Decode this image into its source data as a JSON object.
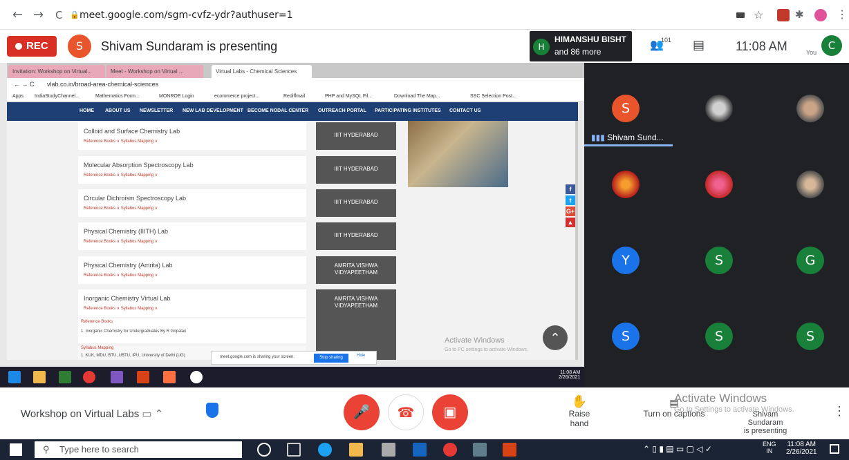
{
  "browser": {
    "url": "meet.google.com/sgm-cvfz-ydr?authuser=1",
    "back_icon": "←",
    "forward_icon": "→",
    "reload_icon": "C"
  },
  "meet_top": {
    "rec_label": "REC",
    "presenter_initial": "S",
    "presenting_text": "Shivam Sundaram is presenting",
    "pinned_initial": "H",
    "pinned_name": "HIMANSHU BISHT",
    "pinned_more": "and 86 more",
    "people_count": "101",
    "time": "11:08 AM",
    "you_label": "You",
    "user_initial": "C"
  },
  "shared_screen": {
    "tabs": [
      "Invitation: Workshop on Virtual...",
      "Meet - Workshop on Virtual ...",
      "Virtual Labs - Chemical Sciences"
    ],
    "address": "vlab.co.in/broad-area-chemical-sciences",
    "bookmarks": [
      "Apps",
      "IndiaStudyChannel...",
      "Mathematics Form...",
      "MONROE Login",
      "ecommerce project...",
      "Rediffmail",
      "PHP and MySQL Fil...",
      "Download The Map...",
      "SSC Selection Post..."
    ],
    "nav": [
      "HOME",
      "ABOUT US",
      "NEWSLETTER",
      "NEW LAB DEVELOPMENT",
      "BECOME NODAL CENTER",
      "OUTREACH PORTAL",
      "PARTICIPATING INSTITUTES",
      "CONTACT US"
    ],
    "labs": [
      {
        "name": "Colloid and Surface Chemistry Lab",
        "links": "Reference Books ∨   Syllabus Mapping ∨",
        "inst": "IIIT HYDERABAD"
      },
      {
        "name": "Molecular Absorption Spectroscopy Lab",
        "links": "Reference Books ∨   Syllabus Mapping ∨",
        "inst": "IIIT HYDERABAD"
      },
      {
        "name": "Circular Dichroism Spectroscopy Lab",
        "links": "Reference Books ∨   Syllabus Mapping ∨",
        "inst": "IIIT HYDERABAD"
      },
      {
        "name": "Physical Chemistry (IIITH) Lab",
        "links": "Reference Books ∨   Syllabus Mapping ∨",
        "inst": "IIIT HYDERABAD"
      },
      {
        "name": "Physical Chemistry (Amrita) Lab",
        "links": "Reference Books ∨   Syllabus Mapping ∨",
        "inst": "AMRITA VISHWA VIDYAPEETHAM"
      },
      {
        "name": "Inorganic Chemistry Virtual Lab",
        "links": "Reference Books ∧   Syllabus Mapping ∧",
        "inst": "AMRITA VISHWA VIDYAPEETHAM"
      }
    ],
    "ref_heading": "Reference Books",
    "ref_item": "1. Inorganic Chemistry for Undergraduates By R Gopalan",
    "syl_heading": "Syllabus Mapping",
    "syl_item": "1. KUK, MDU, BTU, UBTU, IPU, University of Delhi (UG)",
    "share_msg": "meet.google.com is sharing your screen.",
    "stop_label": "Stop sharing",
    "hide_label": "Hide",
    "activate_title": "Activate Windows",
    "activate_sub": "Go to PC settings to activate Windows.",
    "inner_time": "11:08 AM",
    "inner_date": "2/26/2021",
    "social": [
      "f",
      "t",
      "G+",
      "▲"
    ]
  },
  "participants": {
    "speaker_name": "Shivam Sund...",
    "tiles": [
      {
        "initial": "S",
        "color": "#e8542c"
      },
      {
        "initial": "Y",
        "color": "#1a73e8"
      },
      {
        "initial": "S",
        "color": "#188038"
      },
      {
        "initial": "G",
        "color": "#188038"
      },
      {
        "initial": "S",
        "color": "#1a73e8"
      },
      {
        "initial": "S",
        "color": "#188038"
      },
      {
        "initial": "S",
        "color": "#188038"
      }
    ]
  },
  "meet_bottom": {
    "meeting_title": "Workshop on Virtual Labs",
    "raise_hand": "Raise hand",
    "captions": "Turn on captions",
    "activate_title": "Activate Windows",
    "activate_sub": "Go to Settings to activate Windows.",
    "presenter_line1": "Shivam Sundaram",
    "presenter_line2": "is presenting"
  },
  "taskbar": {
    "search_placeholder": "Type here to search",
    "lang": "ENG",
    "region": "IN",
    "time": "11:08 AM",
    "date": "2/26/2021"
  }
}
